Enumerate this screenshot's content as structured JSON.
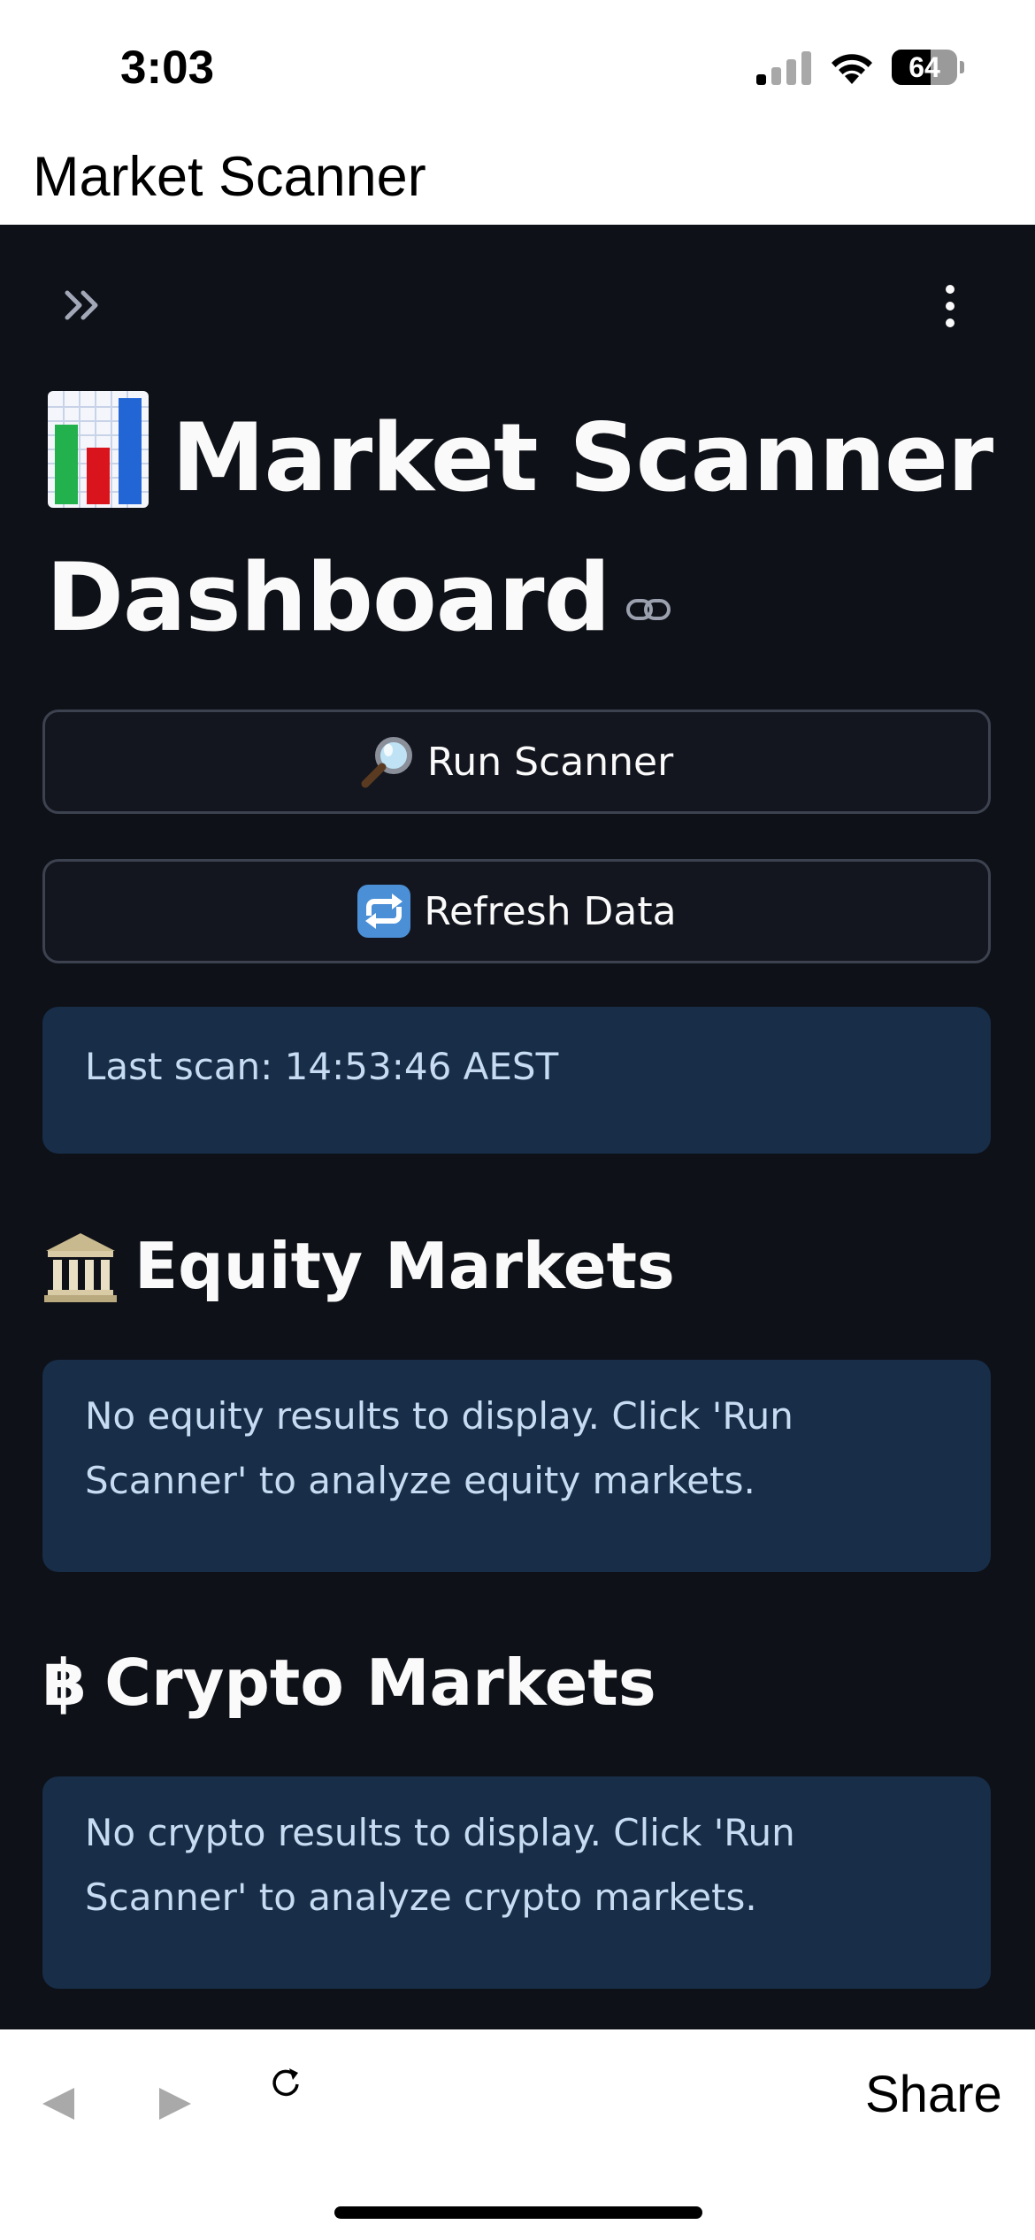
{
  "status_bar": {
    "time": "3:03",
    "battery_level": "64"
  },
  "browser": {
    "title": "Market Scanner",
    "share_label": "Share"
  },
  "page": {
    "title": "Market Scanner Dashboard",
    "run_button_label": "Run Scanner",
    "refresh_button_label": "Refresh Data",
    "last_scan": "Last scan: 14:53:46 AEST"
  },
  "sections": {
    "equity": {
      "heading": "Equity Markets",
      "message": "No equity results to display. Click 'Run Scanner' to analyze equity markets."
    },
    "crypto": {
      "heading": "Crypto Markets",
      "icon_glyph": "฿",
      "message": "No crypto results to display. Click 'Run Scanner' to analyze crypto markets."
    }
  },
  "icons": {
    "title_icon": "bar-chart-icon",
    "run_icon": "magnifier-icon",
    "refresh_icon": "repeat-icon",
    "equity_icon": "bank-icon",
    "crypto_icon": "bitcoin-icon"
  },
  "colors": {
    "app_background": "#0e1117",
    "info_background": "#172d48",
    "info_text": "#c7dcf2",
    "text": "#fafafa"
  }
}
